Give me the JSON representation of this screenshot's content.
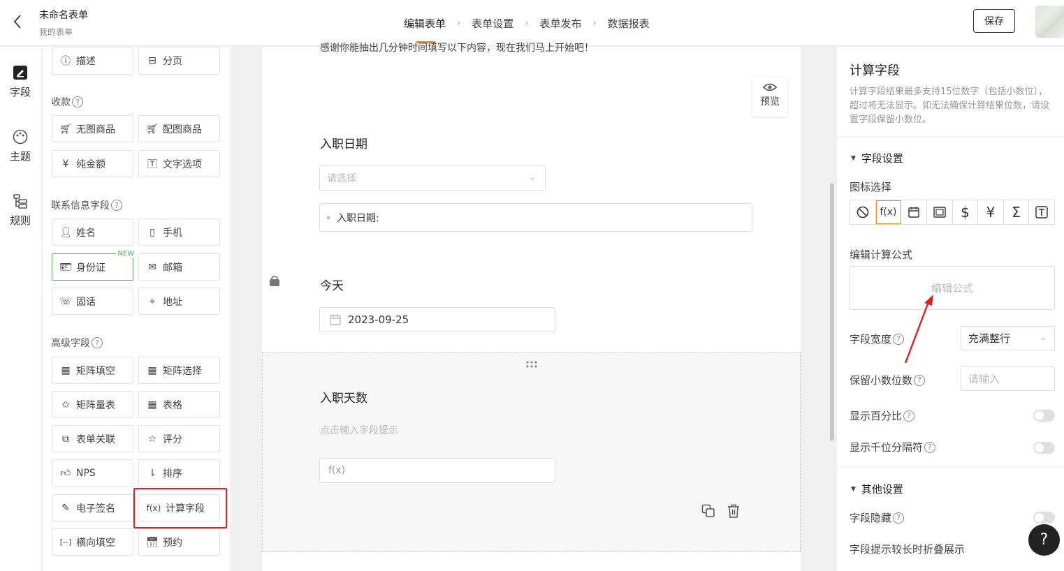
{
  "header": {
    "title": "未命名表单",
    "subtitle": "我的表单",
    "steps": [
      "编辑表单",
      "表单设置",
      "表单发布",
      "数据报表"
    ],
    "save_label": "保存"
  },
  "leftnav": {
    "items": [
      {
        "label": "字段",
        "icon": "field-icon"
      },
      {
        "label": "主题",
        "icon": "palette-icon"
      },
      {
        "label": "规则",
        "icon": "rules-icon"
      }
    ]
  },
  "palette": {
    "top_row": [
      "描述",
      "分页"
    ],
    "sections": {
      "payment": "收款",
      "contact": "联系信息字段",
      "advanced": "高级字段"
    },
    "payment_items": [
      "无图商品",
      "配图商品",
      "纯金额",
      "文字选项"
    ],
    "contact_items": [
      "姓名",
      "手机",
      "身份证",
      "邮箱",
      "固话",
      "地址"
    ],
    "new_tag": "NEW",
    "advanced_items": [
      "矩阵填空",
      "矩阵选择",
      "矩阵量表",
      "表格",
      "表单关联",
      "评分",
      "NPS",
      "排序",
      "电子签名",
      "计算字段",
      "横向填空",
      "预约"
    ]
  },
  "form": {
    "intro": "感谢你能抽出几分钟时间填写以下内容，现在我们马上开始吧！",
    "preview_label": "预览",
    "field1_label": "入职日期",
    "select_placeholder": "请选择",
    "text_value": "入职日期:",
    "field2_label": "今天",
    "date_value": "2023-09-25",
    "field3_label": "入职天数",
    "hint": "点击输入字段提示",
    "fx": "f(x)"
  },
  "rpanel": {
    "title": "计算字段",
    "desc": "计算字段结果最多支持15位数字（包括小数位），超过将无法显示。如无法确保计算结果位数，请设置字段保留小数位。",
    "field_settings": "字段设置",
    "icon_select": "图标选择",
    "icons": [
      "⃠",
      "f(x)",
      "▦",
      "▣",
      "$",
      "¥",
      "Σ",
      "T"
    ],
    "edit_formula_label": "编辑计算公式",
    "formula_placeholder": "编辑公式",
    "width_label": "字段宽度",
    "width_value": "充满整行",
    "decimal_label": "保留小数位数",
    "decimal_placeholder": "请输入",
    "percent_label": "显示百分比",
    "thousand_label": "显示千位分隔符",
    "other_settings": "其他设置",
    "hide_label": "字段隐藏",
    "collapse_label": "字段提示较长时折叠展示"
  },
  "help": "?"
}
